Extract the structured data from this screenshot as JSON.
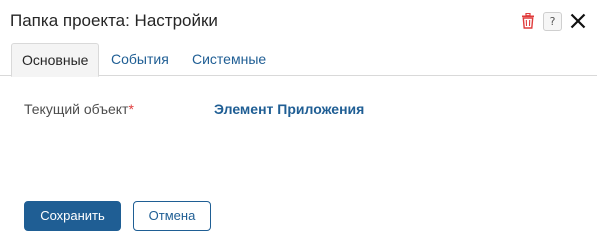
{
  "dialog": {
    "title": "Папка проекта: Настройки",
    "help_label": "?"
  },
  "tabs": [
    {
      "label": "Основные",
      "active": true
    },
    {
      "label": "События",
      "active": false
    },
    {
      "label": "Системные",
      "active": false
    }
  ],
  "form": {
    "field_label": "Текущий объект",
    "required_mark": "*",
    "field_value": "Элемент Приложения"
  },
  "buttons": {
    "save_label": "Сохранить",
    "cancel_label": "Отмена"
  },
  "colors": {
    "accent": "#1f5e94",
    "delete_icon": "#e03b3b",
    "required": "#e03b3b"
  },
  "icons": [
    "trash-icon",
    "help-icon",
    "close-icon"
  ]
}
